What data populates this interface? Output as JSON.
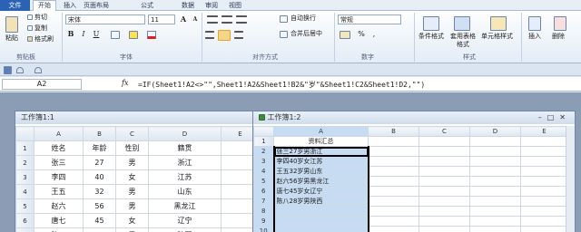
{
  "menu": {
    "file": "文件",
    "home": "开始",
    "tabs": [
      "插入",
      "页面布局",
      "公式",
      "数据",
      "审阅",
      "视图"
    ]
  },
  "ribbon": {
    "clipboard": {
      "label": "剪贴板",
      "paste": "粘贴",
      "cut": "剪切",
      "copy": "复制",
      "format_painter": "格式刷"
    },
    "font": {
      "label": "字体",
      "font_name": "宋体",
      "font_size": "11",
      "bold": "B",
      "italic": "I",
      "underline": "U",
      "grow": "A",
      "shrink": "A"
    },
    "alignment": {
      "label": "对齐方式",
      "wrap": "自动换行",
      "merge": "合并后居中"
    },
    "number": {
      "label": "数字",
      "format": "常规",
      "percent": "%",
      "comma": ","
    },
    "styles": {
      "label": "样式",
      "conditional": "条件格式",
      "table": "套用表格格式",
      "cell": "单元格样式"
    },
    "cells": {
      "insert": "插入",
      "delete": "删除"
    }
  },
  "formula_bar": {
    "name_box": "A2",
    "fx": "fx",
    "formula": "=IF(Sheet1!A2<>\"\",Sheet1!A2&Sheet1!B2&\"岁\"&Sheet1!C2&Sheet1!D2,\"\")"
  },
  "window1": {
    "title": "工作簿1:1",
    "col_headers": [
      "A",
      "B",
      "C",
      "D",
      "E"
    ],
    "rows": [
      {
        "n": "1",
        "cells": [
          "姓名",
          "年龄",
          "性别",
          "籍贯",
          ""
        ]
      },
      {
        "n": "2",
        "cells": [
          "张三",
          "27",
          "男",
          "浙江",
          ""
        ]
      },
      {
        "n": "3",
        "cells": [
          "李四",
          "40",
          "女",
          "江苏",
          ""
        ]
      },
      {
        "n": "4",
        "cells": [
          "王五",
          "32",
          "男",
          "山东",
          ""
        ]
      },
      {
        "n": "5",
        "cells": [
          "赵六",
          "56",
          "男",
          "黑龙江",
          ""
        ]
      },
      {
        "n": "6",
        "cells": [
          "唐七",
          "45",
          "女",
          "辽宁",
          ""
        ]
      },
      {
        "n": "7",
        "cells": [
          "陈八",
          "28",
          "男",
          "陕西",
          ""
        ]
      }
    ]
  },
  "window2": {
    "title": "工作簿1:2",
    "col_headers": [
      "A",
      "B",
      "C",
      "D",
      "E"
    ],
    "rows": [
      {
        "n": "1",
        "a": "资料汇总"
      },
      {
        "n": "2",
        "a": "张三27岁男浙江"
      },
      {
        "n": "3",
        "a": "李四40岁女江苏"
      },
      {
        "n": "4",
        "a": "王五32岁男山东"
      },
      {
        "n": "5",
        "a": "赵六56岁男黑龙江"
      },
      {
        "n": "6",
        "a": "唐七45岁女辽宁"
      },
      {
        "n": "7",
        "a": "陈八28岁男陕西"
      },
      {
        "n": "8",
        "a": ""
      },
      {
        "n": "9",
        "a": ""
      },
      {
        "n": "10",
        "a": ""
      }
    ]
  },
  "colors": {
    "selection": "#c6dcf3",
    "file_tab": "#2a63b5",
    "grid": "#d0d7e5"
  }
}
